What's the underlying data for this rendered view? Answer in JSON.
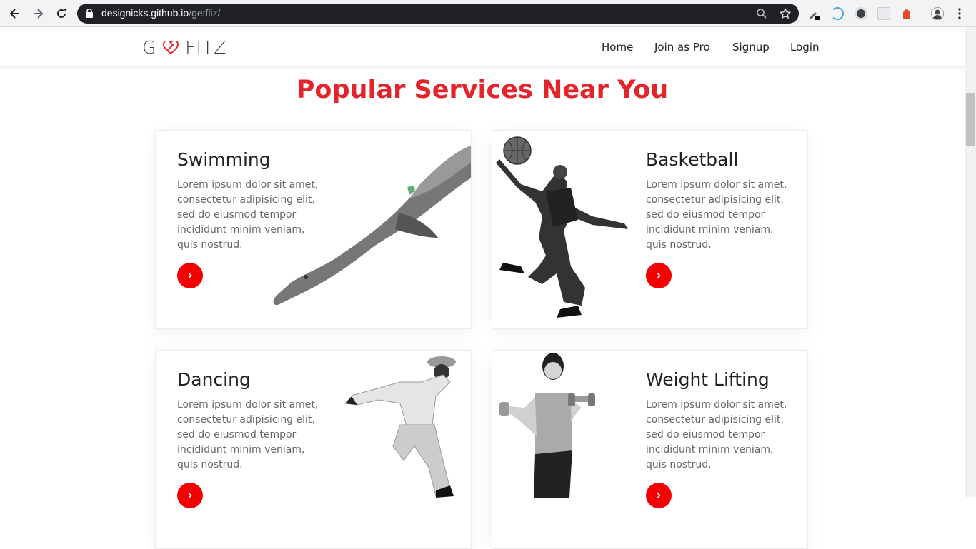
{
  "browser": {
    "url_host": "designicks.github.io",
    "url_path": "/getfliz/"
  },
  "site": {
    "logo": {
      "part1": "G",
      "part2": "FITZ"
    },
    "nav": [
      {
        "label": "Home"
      },
      {
        "label": "Join as Pro"
      },
      {
        "label": "Signup"
      },
      {
        "label": "Login"
      }
    ]
  },
  "section": {
    "title": "Popular Services Near You"
  },
  "cards": [
    {
      "title": "Swimming",
      "text": "Lorem ipsum dolor sit amet, consectetur adipisicing elit, sed do eiusmod tempor incididunt minim veniam, quis nostrud.",
      "image": "swimmer-image"
    },
    {
      "title": "Basketball",
      "text": "Lorem ipsum dolor sit amet, consectetur adipisicing elit, sed do eiusmod tempor incididunt minim veniam, quis nostrud.",
      "image": "basketball-player-image"
    },
    {
      "title": "Dancing",
      "text": "Lorem ipsum dolor sit amet, consectetur adipisicing elit, sed do eiusmod tempor incididunt minim veniam, quis nostrud.",
      "image": "dancer-image"
    },
    {
      "title": "Weight Lifting",
      "text": "Lorem ipsum dolor sit amet, consectetur adipisicing elit, sed do eiusmod tempor incididunt minim veniam, quis nostrud.",
      "image": "weightlifter-image"
    }
  ],
  "colors": {
    "accent": "#e3242b",
    "button": "#f40000"
  }
}
